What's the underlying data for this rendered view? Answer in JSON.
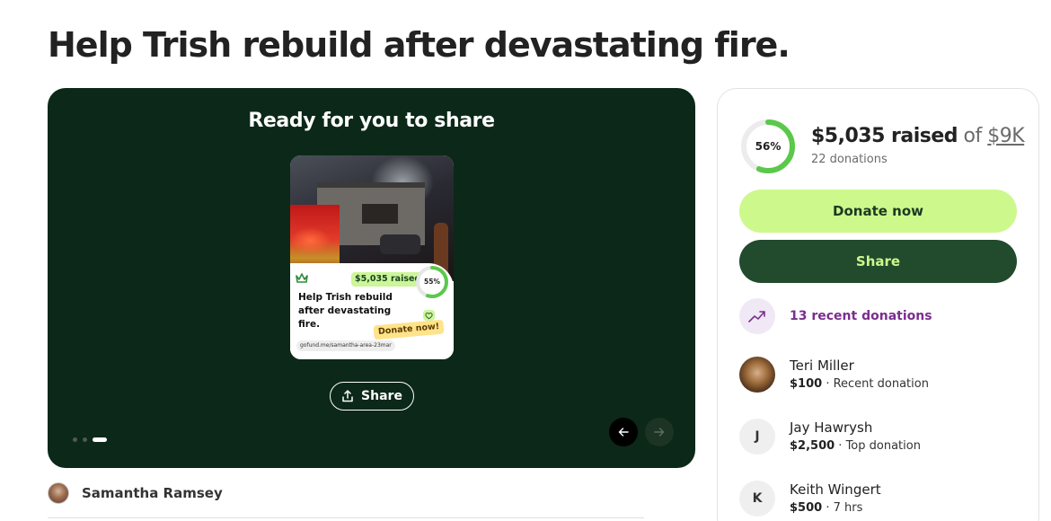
{
  "page_title": "Help Trish rebuild after devastating fire.",
  "hero": {
    "heading": "Ready for you to share",
    "preview": {
      "raised_badge": "$5,035 raised",
      "progress_percent": 55,
      "progress_label": "55%",
      "title": "Help Trish rebuild after devastating fire.",
      "donate_label": "Donate now!",
      "url": "gofund.me/samantha-area-23mar"
    },
    "share_label": "Share",
    "carousel": {
      "slides": 3,
      "active_index": 2
    }
  },
  "organizer": {
    "name": "Samantha Ramsey"
  },
  "sidebar": {
    "progress_percent": 56,
    "progress_label": "56%",
    "raised_amount": "$5,035 raised",
    "of_text": " of ",
    "goal": "$9K",
    "donation_count": "22 donations",
    "donate_button": "Donate now",
    "share_button": "Share",
    "recent_donations_label": "13 recent donations",
    "donors": [
      {
        "name": "Teri Miller",
        "amount": "$100",
        "note": " · Recent donation",
        "initial": ""
      },
      {
        "name": "Jay Hawrysh",
        "amount": "$2,500",
        "note": " · Top donation",
        "initial": "J"
      },
      {
        "name": "Keith Wingert",
        "amount": "$500",
        "note": " · 7 hrs",
        "initial": "K"
      }
    ]
  },
  "colors": {
    "hero_bg": "#0b2818",
    "accent_green": "#cdf88c",
    "dark_green": "#224a2c",
    "progress_green": "#5ac84b",
    "recent_purple": "#7a2e8e"
  },
  "icons": [
    "crown-icon",
    "heart-icon",
    "upload-icon",
    "arrow-left-icon",
    "arrow-right-icon",
    "trending-up-icon"
  ]
}
